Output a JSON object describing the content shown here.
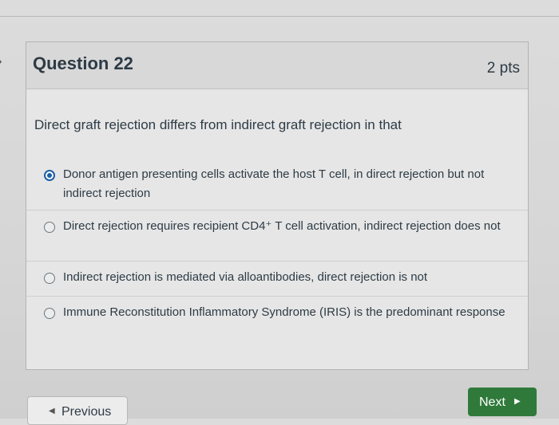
{
  "question": {
    "title": "Question 22",
    "points": "2 pts",
    "text": "Direct graft rejection differs from indirect graft rejection in that"
  },
  "answers": [
    {
      "label": "Donor antigen presenting cells activate the host T cell, in direct rejection but not indirect rejection",
      "selected": true
    },
    {
      "label": "Direct rejection requires recipient CD4⁺ T cell activation, indirect rejection does not",
      "selected": false
    },
    {
      "label": "Indirect rejection is mediated via alloantibodies, direct rejection is not",
      "selected": false
    },
    {
      "label": "Immune Reconstitution Inflammatory Syndrome (IRIS) is the predominant response",
      "selected": false
    }
  ],
  "nav": {
    "previous_label": "Previous",
    "next_label": "Next",
    "previous_icon": "triangle-left",
    "next_icon": "triangle-right"
  },
  "colors": {
    "accent": "#1a5ea8",
    "next_button": "#2f7a3a",
    "text": "#2d3b45"
  }
}
